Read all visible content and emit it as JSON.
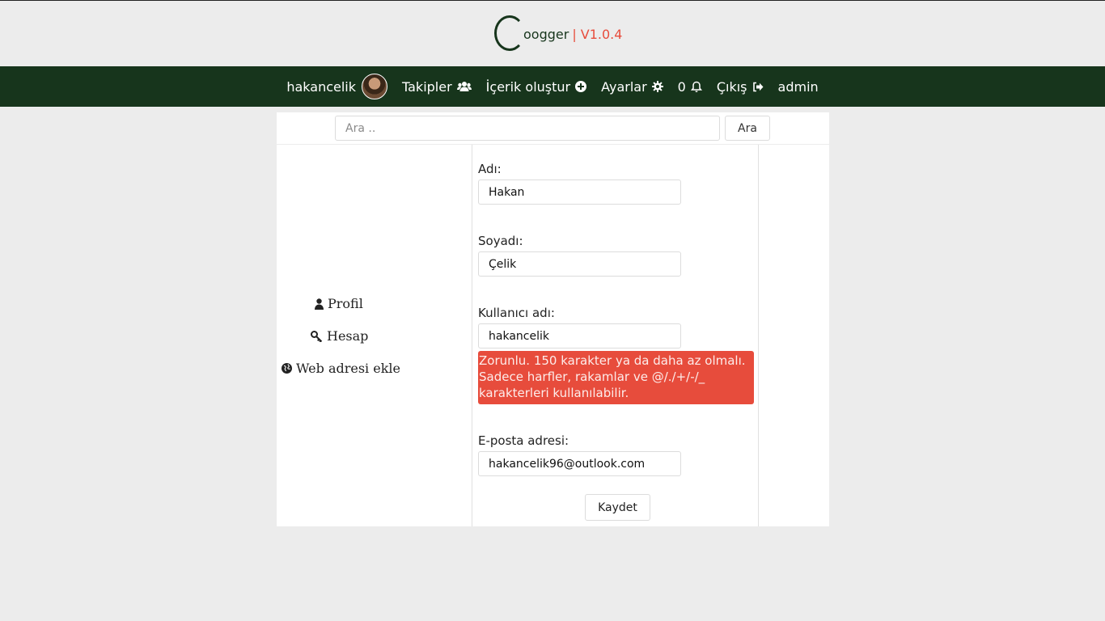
{
  "header": {
    "logo_text": "oogger",
    "version": "| V1.0.4"
  },
  "navbar": {
    "username": "hakancelik",
    "items": [
      {
        "label": "Takipler",
        "icon": "users-icon"
      },
      {
        "label": "İçerik oluştur",
        "icon": "plus-circle-icon"
      },
      {
        "label": "Ayarlar",
        "icon": "gear-icon"
      },
      {
        "label": "0",
        "icon": "bell-icon"
      },
      {
        "label": "Çıkış",
        "icon": "sign-out-icon"
      },
      {
        "label": "admin",
        "icon": ""
      }
    ]
  },
  "search": {
    "placeholder": "Ara ..",
    "button_label": "Ara"
  },
  "sidebar": {
    "items": [
      {
        "label": "Profil",
        "icon": "user-icon"
      },
      {
        "label": "Hesap",
        "icon": "key-icon"
      },
      {
        "label": "Web adresi ekle",
        "icon": "globe-icon"
      }
    ]
  },
  "form": {
    "first_name_label": "Adı:",
    "first_name_value": "Hakan",
    "last_name_label": "Soyadı:",
    "last_name_value": "Çelik",
    "username_label": "Kullanıcı adı:",
    "username_value": "hakancelik",
    "username_help": "Zorunlu. 150 karakter ya da daha az olmalı. Sadece harfler, rakamlar ve @/./+/-/_ karakterleri kullanılabilir.",
    "email_label": "E-posta adresi:",
    "email_value": "hakancelik96@outlook.com",
    "save_label": "Kaydet"
  },
  "colors": {
    "brand_dark_green": "#17351c",
    "accent_red": "#e74c3c",
    "background": "#ececec"
  }
}
